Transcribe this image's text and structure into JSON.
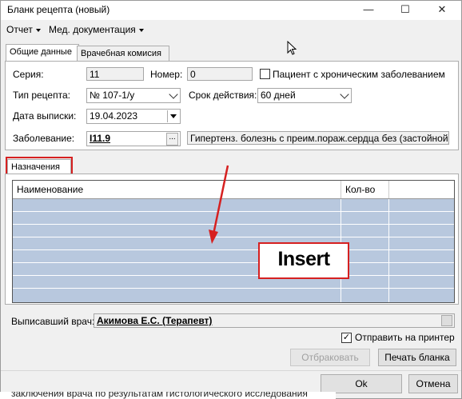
{
  "window": {
    "title": "Бланк рецепта (новый)",
    "minimize": "—",
    "maximize": "☐",
    "close": "✕"
  },
  "menu": {
    "report": "Отчет",
    "meddoc": "Мед. документация"
  },
  "tabs": {
    "general": "Общие данные",
    "commission": "Врачебная комисия"
  },
  "form": {
    "series_label": "Серия:",
    "series_value": "11",
    "number_label": "Номер:",
    "number_value": "0",
    "chronic_label": "Пациент с хроническим заболеванием",
    "type_label": "Тип рецепта:",
    "type_value": "№ 107-1/у",
    "validity_label": "Срок действия:",
    "validity_value": "60 дней",
    "date_label": "Дата выписки:",
    "date_value": "19.04.2023",
    "disease_label": "Заболевание:",
    "disease_code": "I11.9",
    "ellipsis": "...",
    "disease_desc": "Гипертенз. болезнь с преим.пораж.сердца без (застойной) сер"
  },
  "assignments": {
    "tab": "Назначения",
    "col_name": "Наименование",
    "col_qty": "Кол-во",
    "overlay": "Insert"
  },
  "doctor": {
    "label": "Выписавший врач:",
    "value": "Акимова Е.С. (Терапевт)"
  },
  "print_option": {
    "label": "Отправить на принтер",
    "checked": true
  },
  "buttons": {
    "reject": "Отбраковать",
    "print": "Печать бланка",
    "ok": "Ok",
    "cancel": "Отмена"
  },
  "background_text": "заключения врача по результатам гистологического исследования"
}
